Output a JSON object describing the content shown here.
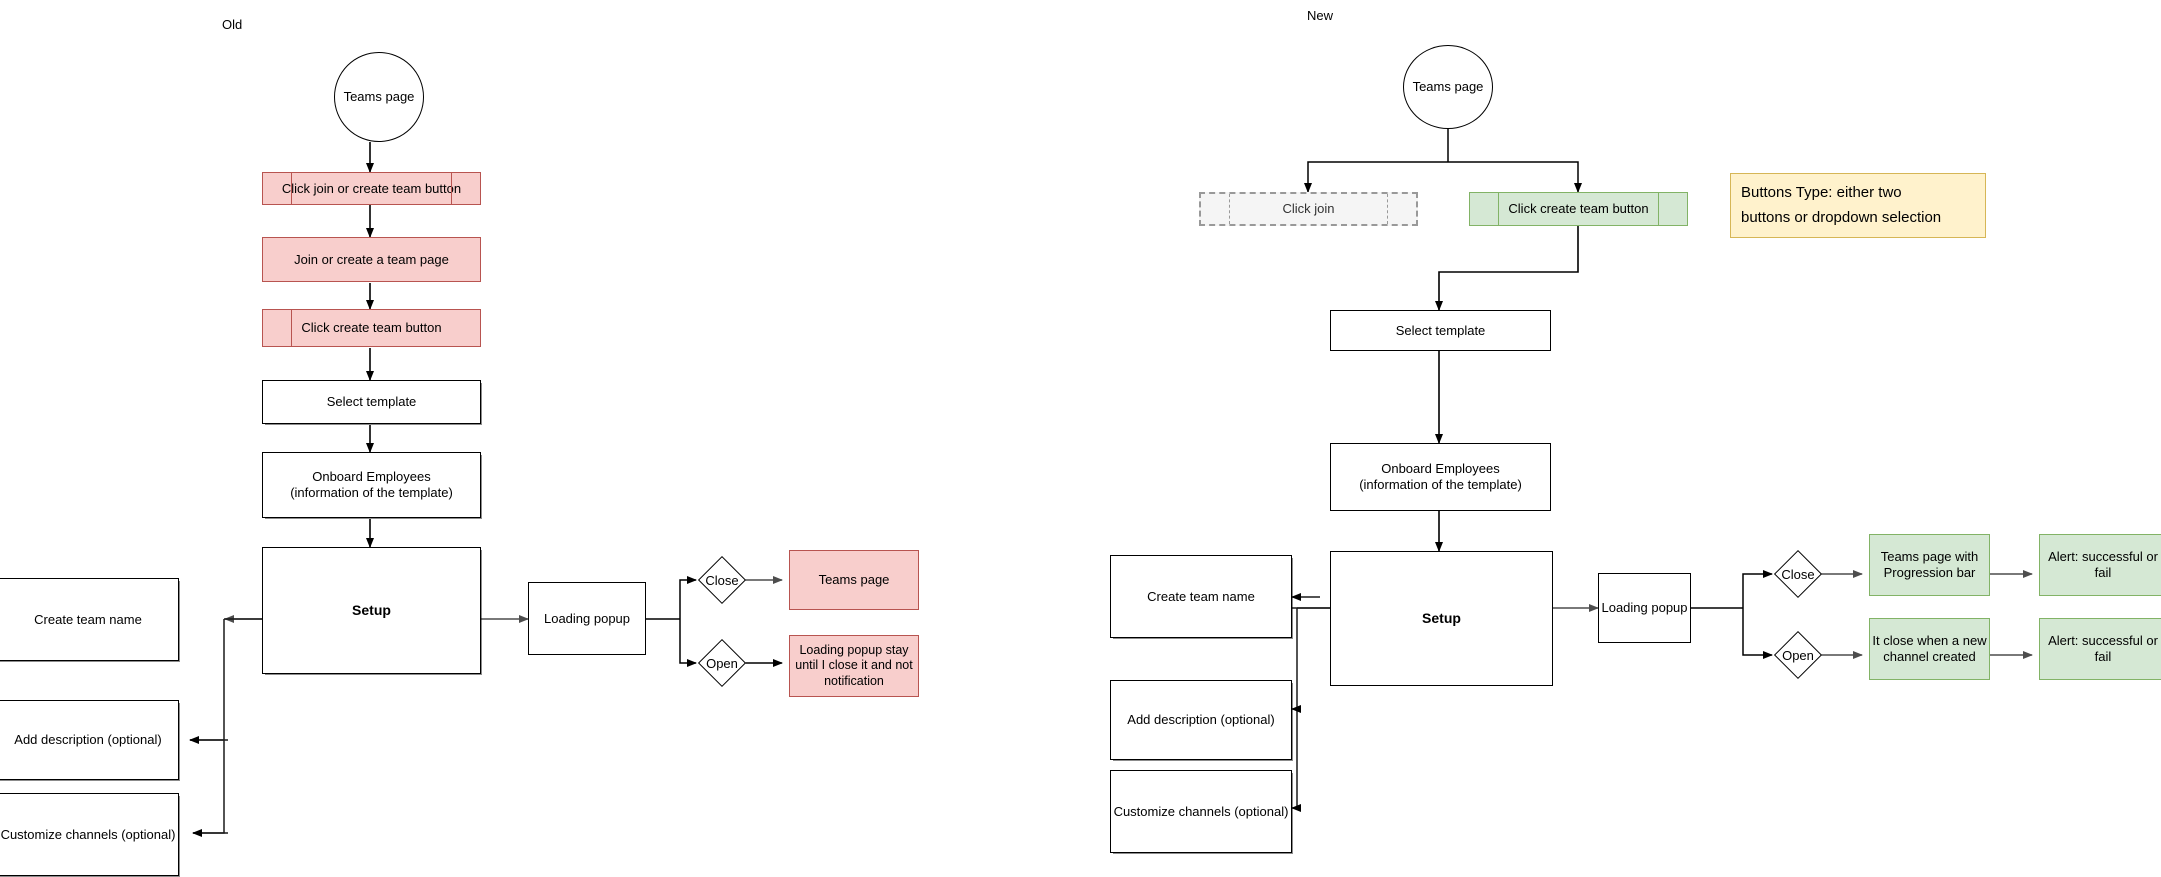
{
  "diagram": {
    "title_old": "Old",
    "title_new": "New",
    "colors": {
      "pink_fill": "#f8cecc",
      "pink_border": "#b85450",
      "green_fill": "#d5e8d4",
      "green_border": "#82b366",
      "yellow_fill": "#fff2cc",
      "yellow_border": "#d6b656",
      "gray_fill": "#f5f5f5",
      "gray_border": "#999999",
      "white_fill": "#ffffff",
      "black_border": "#000000"
    }
  },
  "old_flow": {
    "start": "Teams page",
    "step_click_join_or_create": "Click join or create team button",
    "step_join_or_create_page": "Join or create a team page",
    "step_click_create_team": "Click create team button",
    "step_select_template": "Select template",
    "step_onboard": "Onboard Employees\n(information of the template)",
    "step_setup": "Setup",
    "step_loading_popup": "Loading popup",
    "branch_close": "Close",
    "branch_open": "Open",
    "outcome_close": "Teams page",
    "outcome_open": "Loading popup stay until I close it and not notification",
    "side_create_team_name": "Create team name",
    "side_add_description": "Add description (optional)",
    "side_customize_channels": "Customize channels (optional)"
  },
  "new_flow": {
    "start": "Teams page",
    "step_click_join": "Click join",
    "step_click_create_team": "Click create team button",
    "note_buttons_type": "Buttons Type: either two\nbuttons or dropdown selection",
    "step_select_template": "Select template",
    "step_onboard": "Onboard Employees\n(information of the template)",
    "step_setup": "Setup",
    "step_loading_popup": "Loading popup",
    "branch_close": "Close",
    "branch_open": "Open",
    "outcome_close": "Teams page with\nProgression bar",
    "outcome_open": "It close when a new\nchannel created",
    "alert_close": "Alert: successful or\nfail",
    "alert_open": "Alert: successful or\nfail",
    "side_create_team_name": "Create team name",
    "side_add_description": "Add description (optional)",
    "side_customize_channels": "Customize channels (optional)"
  }
}
